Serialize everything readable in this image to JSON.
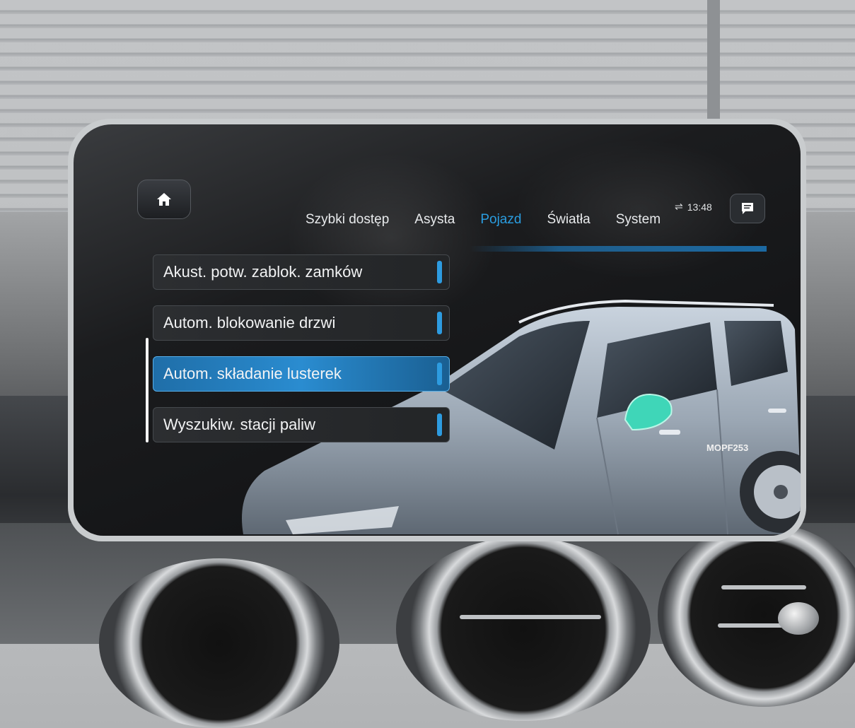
{
  "header": {
    "home_icon": "home-icon",
    "tabs": [
      {
        "label": "Szybki dostęp",
        "active": false
      },
      {
        "label": "Asysta",
        "active": false
      },
      {
        "label": "Pojazd",
        "active": true
      },
      {
        "label": "Światła",
        "active": false
      },
      {
        "label": "System",
        "active": false
      }
    ],
    "time": "13:48",
    "status_icon": "connection-icon",
    "message_icon": "message-icon"
  },
  "menu": {
    "items": [
      {
        "label": "Akust. potw. zablok. zamków",
        "selected": false
      },
      {
        "label": "Autom. blokowanie drzwi",
        "selected": false
      },
      {
        "label": "Autom. składanie lusterek",
        "selected": true
      },
      {
        "label": "Wyszukiw. stacji paliw",
        "selected": false
      }
    ]
  },
  "vehicle": {
    "code": "MOPF253",
    "highlight": "mirror"
  },
  "colors": {
    "accent": "#2a9de0",
    "selected_item": "#2a8cd0",
    "mirror_highlight": "#3fd6b8"
  }
}
